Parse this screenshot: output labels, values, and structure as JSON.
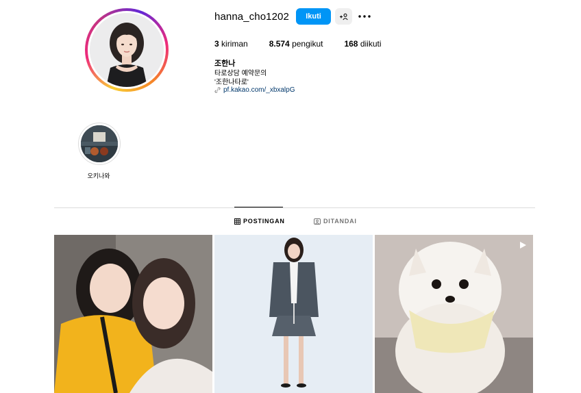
{
  "profile": {
    "username": "hanna_cho1202",
    "follow_label": "Ikuti",
    "add_user_icon": "add-user-icon",
    "more_icon": "more-horizontal-icon",
    "stats": {
      "posts": "3",
      "posts_label": "kiriman",
      "followers": "8.574",
      "followers_label": "pengikut",
      "following": "168",
      "following_label": "diikuti"
    },
    "full_name": "조한나",
    "bio_line1": "타로상담 예약문의",
    "bio_line2": "'조한나타로'",
    "link": "pf.kakao.com/_xbxalpG"
  },
  "highlights": [
    {
      "label": "오키나와"
    }
  ],
  "tabs": [
    {
      "label": "POSTINGAN",
      "icon": "grid-icon",
      "active": true
    },
    {
      "label": "DITANDAI",
      "icon": "tagged-icon",
      "active": false
    }
  ],
  "posts": [
    {
      "kind": "photo"
    },
    {
      "kind": "photo"
    },
    {
      "kind": "video",
      "icon": "reel-icon"
    }
  ],
  "colors": {
    "primary_button": "#0095f6",
    "link": "#00376b",
    "divider": "#dbdbdb"
  }
}
